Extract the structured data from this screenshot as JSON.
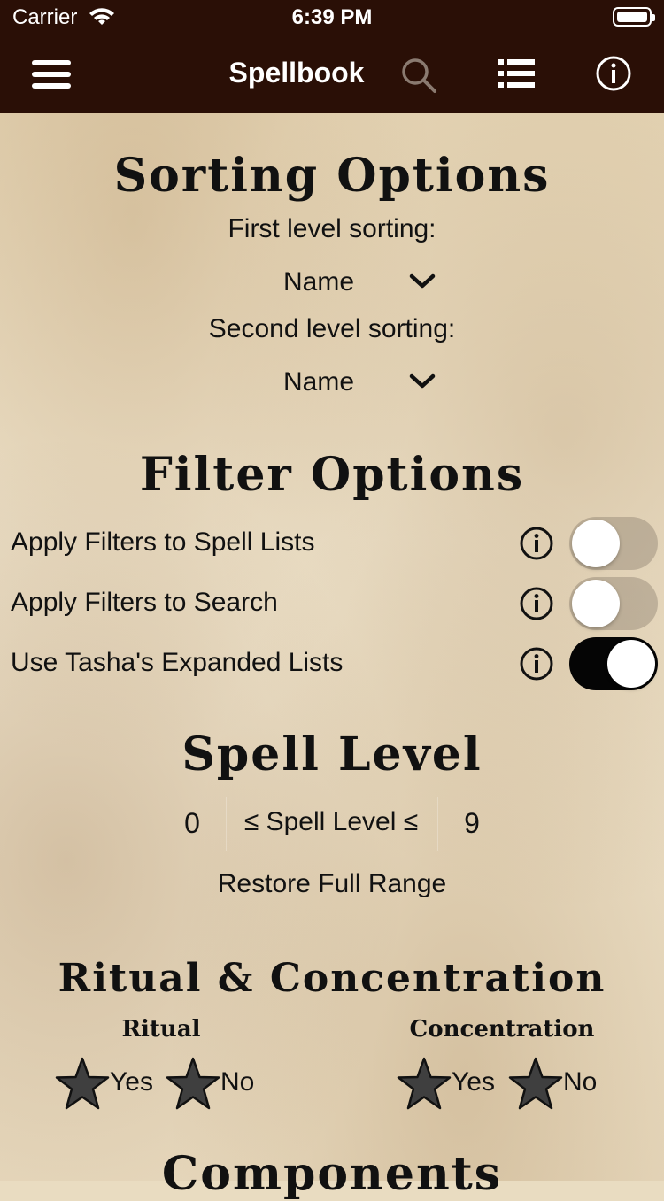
{
  "status_bar": {
    "carrier": "Carrier",
    "time": "6:39 PM"
  },
  "nav": {
    "title": "Spellbook",
    "icons": [
      "hamburger-menu-icon",
      "search-icon",
      "list-icon",
      "info-icon"
    ]
  },
  "sorting": {
    "heading": "Sorting Options",
    "first_label": "First level sorting:",
    "first_value": "Name",
    "second_label": "Second level sorting:",
    "second_value": "Name"
  },
  "filter": {
    "heading": "Filter Options",
    "rows": [
      {
        "label": "Apply Filters to Spell Lists",
        "on": false
      },
      {
        "label": "Apply Filters to Search",
        "on": false
      },
      {
        "label": "Use Tasha's Expanded Lists",
        "on": true
      }
    ]
  },
  "spell_level": {
    "heading": "Spell Level",
    "min": "0",
    "middle": "≤ Spell Level ≤",
    "max": "9",
    "restore": "Restore Full Range"
  },
  "ritual_conc": {
    "heading": "Ritual & Concentration",
    "ritual": {
      "title": "Ritual",
      "yes": "Yes",
      "no": "No"
    },
    "concentration": {
      "title": "Concentration",
      "yes": "Yes",
      "no": "No"
    }
  },
  "components": {
    "heading": "Components"
  },
  "colors": {
    "navbar": "#2a0f06",
    "toggle_on": "#050505",
    "text": "#111111"
  }
}
